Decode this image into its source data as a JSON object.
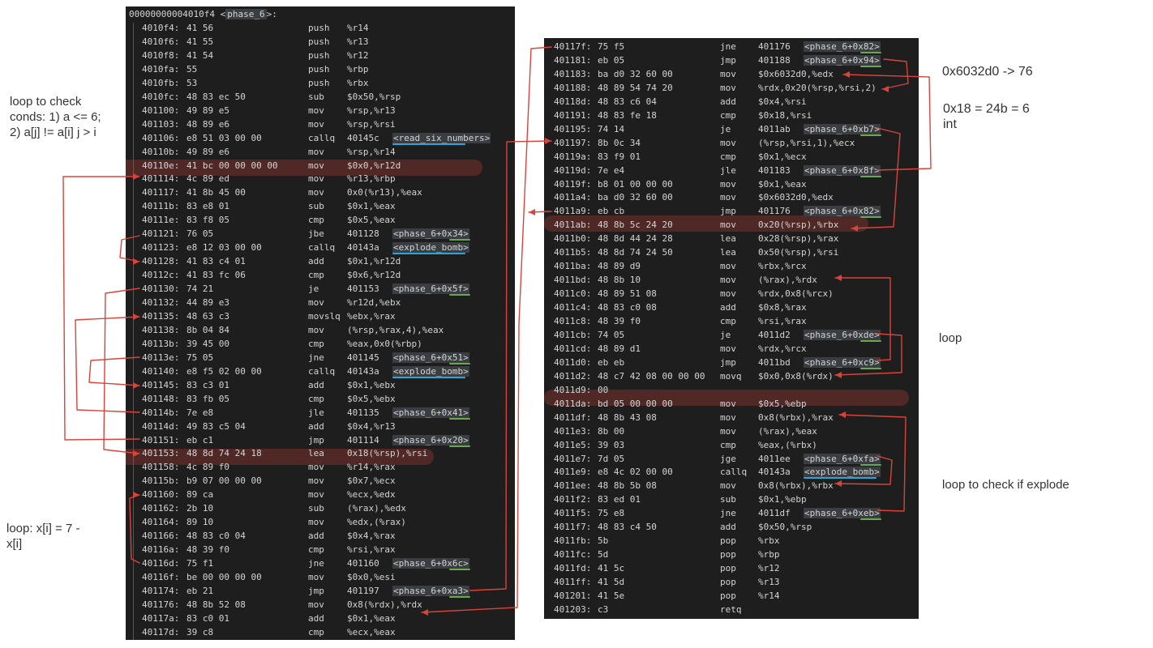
{
  "left_panel": {
    "header": {
      "address": "00000000004010f4",
      "symbol": "phase_6"
    },
    "rows": [
      {
        "addr": "4010f4:",
        "bytes": "41 56",
        "mnemonic": "push",
        "operand": "%r14"
      },
      {
        "addr": "4010f6:",
        "bytes": "41 55",
        "mnemonic": "push",
        "operand": "%r13"
      },
      {
        "addr": "4010f8:",
        "bytes": "41 54",
        "mnemonic": "push",
        "operand": "%r12"
      },
      {
        "addr": "4010fa:",
        "bytes": "55",
        "mnemonic": "push",
        "operand": "%rbp"
      },
      {
        "addr": "4010fb:",
        "bytes": "53",
        "mnemonic": "push",
        "operand": "%rbx"
      },
      {
        "addr": "4010fc:",
        "bytes": "48 83 ec 50",
        "mnemonic": "sub",
        "operand": "$0x50,%rsp"
      },
      {
        "addr": "401100:",
        "bytes": "49 89 e5",
        "mnemonic": "mov",
        "operand": "%rsp,%r13"
      },
      {
        "addr": "401103:",
        "bytes": "48 89 e6",
        "mnemonic": "mov",
        "operand": "%rsp,%rsi"
      },
      {
        "addr": "401106:",
        "bytes": "e8 51 03 00 00",
        "mnemonic": "callq",
        "operand": "40145c ",
        "symbol": "<read_six_numbers>"
      },
      {
        "addr": "40110b:",
        "bytes": "49 89 e6",
        "mnemonic": "mov",
        "operand": "%rsp,%r14"
      },
      {
        "addr": "40110e:",
        "bytes": "41 bc 00 00 00 00",
        "mnemonic": "mov",
        "operand": "$0x0,%r12d"
      },
      {
        "addr": "401114:",
        "bytes": "4c 89 ed",
        "mnemonic": "mov",
        "operand": "%r13,%rbp"
      },
      {
        "addr": "401117:",
        "bytes": "41 8b 45 00",
        "mnemonic": "mov",
        "operand": "0x0(%r13),%eax"
      },
      {
        "addr": "40111b:",
        "bytes": "83 e8 01",
        "mnemonic": "sub",
        "operand": "$0x1,%eax"
      },
      {
        "addr": "40111e:",
        "bytes": "83 f8 05",
        "mnemonic": "cmp",
        "operand": "$0x5,%eax"
      },
      {
        "addr": "401121:",
        "bytes": "76 05",
        "mnemonic": "jbe",
        "operand": "401128 ",
        "symbol": "<phase_6+0x34>"
      },
      {
        "addr": "401123:",
        "bytes": "e8 12 03 00 00",
        "mnemonic": "callq",
        "operand": "40143a ",
        "symbol": "<explode_bomb>"
      },
      {
        "addr": "401128:",
        "bytes": "41 83 c4 01",
        "mnemonic": "add",
        "operand": "$0x1,%r12d"
      },
      {
        "addr": "40112c:",
        "bytes": "41 83 fc 06",
        "mnemonic": "cmp",
        "operand": "$0x6,%r12d"
      },
      {
        "addr": "401130:",
        "bytes": "74 21",
        "mnemonic": "je",
        "operand": "401153 ",
        "symbol": "<phase_6+0x5f>"
      },
      {
        "addr": "401132:",
        "bytes": "44 89 e3",
        "mnemonic": "mov",
        "operand": "%r12d,%ebx"
      },
      {
        "addr": "401135:",
        "bytes": "48 63 c3",
        "mnemonic": "movslq",
        "operand": "%ebx,%rax"
      },
      {
        "addr": "401138:",
        "bytes": "8b 04 84",
        "mnemonic": "mov",
        "operand": "(%rsp,%rax,4),%eax"
      },
      {
        "addr": "40113b:",
        "bytes": "39 45 00",
        "mnemonic": "cmp",
        "operand": "%eax,0x0(%rbp)"
      },
      {
        "addr": "40113e:",
        "bytes": "75 05",
        "mnemonic": "jne",
        "operand": "401145 ",
        "symbol": "<phase_6+0x51>"
      },
      {
        "addr": "401140:",
        "bytes": "e8 f5 02 00 00",
        "mnemonic": "callq",
        "operand": "40143a ",
        "symbol": "<explode_bomb>"
      },
      {
        "addr": "401145:",
        "bytes": "83 c3 01",
        "mnemonic": "add",
        "operand": "$0x1,%ebx"
      },
      {
        "addr": "401148:",
        "bytes": "83 fb 05",
        "mnemonic": "cmp",
        "operand": "$0x5,%ebx"
      },
      {
        "addr": "40114b:",
        "bytes": "7e e8",
        "mnemonic": "jle",
        "operand": "401135 ",
        "symbol": "<phase_6+0x41>"
      },
      {
        "addr": "40114d:",
        "bytes": "49 83 c5 04",
        "mnemonic": "add",
        "operand": "$0x4,%r13"
      },
      {
        "addr": "401151:",
        "bytes": "eb c1",
        "mnemonic": "jmp",
        "operand": "401114 ",
        "symbol": "<phase_6+0x20>"
      },
      {
        "addr": "401153:",
        "bytes": "48 8d 74 24 18",
        "mnemonic": "lea",
        "operand": "0x18(%rsp),%rsi"
      },
      {
        "addr": "401158:",
        "bytes": "4c 89 f0",
        "mnemonic": "mov",
        "operand": "%r14,%rax"
      },
      {
        "addr": "40115b:",
        "bytes": "b9 07 00 00 00",
        "mnemonic": "mov",
        "operand": "$0x7,%ecx"
      },
      {
        "addr": "401160:",
        "bytes": "89 ca",
        "mnemonic": "mov",
        "operand": "%ecx,%edx"
      },
      {
        "addr": "401162:",
        "bytes": "2b 10",
        "mnemonic": "sub",
        "operand": "(%rax),%edx"
      },
      {
        "addr": "401164:",
        "bytes": "89 10",
        "mnemonic": "mov",
        "operand": "%edx,(%rax)"
      },
      {
        "addr": "401166:",
        "bytes": "48 83 c0 04",
        "mnemonic": "add",
        "operand": "$0x4,%rax"
      },
      {
        "addr": "40116a:",
        "bytes": "48 39 f0",
        "mnemonic": "cmp",
        "operand": "%rsi,%rax"
      },
      {
        "addr": "40116d:",
        "bytes": "75 f1",
        "mnemonic": "jne",
        "operand": "401160 ",
        "symbol": "<phase_6+0x6c>"
      },
      {
        "addr": "40116f:",
        "bytes": "be 00 00 00 00",
        "mnemonic": "mov",
        "operand": "$0x0,%esi"
      },
      {
        "addr": "401174:",
        "bytes": "eb 21",
        "mnemonic": "jmp",
        "operand": "401197 ",
        "symbol": "<phase_6+0xa3>"
      },
      {
        "addr": "401176:",
        "bytes": "48 8b 52 08",
        "mnemonic": "mov",
        "operand": "0x8(%rdx),%rdx"
      },
      {
        "addr": "40117a:",
        "bytes": "83 c0 01",
        "mnemonic": "add",
        "operand": "$0x1,%eax"
      },
      {
        "addr": "40117d:",
        "bytes": "39 c8",
        "mnemonic": "cmp",
        "operand": "%ecx,%eax"
      }
    ]
  },
  "right_panel": {
    "rows": [
      {
        "addr": "40117f:",
        "bytes": "75 f5",
        "mnemonic": "jne",
        "operand": "401176 ",
        "symbol": "<phase_6+0x82>"
      },
      {
        "addr": "401181:",
        "bytes": "eb 05",
        "mnemonic": "jmp",
        "operand": "401188 ",
        "symbol": "<phase_6+0x94>"
      },
      {
        "addr": "401183:",
        "bytes": "ba d0 32 60 00",
        "mnemonic": "mov",
        "operand": "$0x6032d0,%edx"
      },
      {
        "addr": "401188:",
        "bytes": "48 89 54 74 20",
        "mnemonic": "mov",
        "operand": "%rdx,0x20(%rsp,%rsi,2)"
      },
      {
        "addr": "40118d:",
        "bytes": "48 83 c6 04",
        "mnemonic": "add",
        "operand": "$0x4,%rsi"
      },
      {
        "addr": "401191:",
        "bytes": "48 83 fe 18",
        "mnemonic": "cmp",
        "operand": "$0x18,%rsi"
      },
      {
        "addr": "401195:",
        "bytes": "74 14",
        "mnemonic": "je",
        "operand": "4011ab ",
        "symbol": "<phase_6+0xb7>"
      },
      {
        "addr": "401197:",
        "bytes": "8b 0c 34",
        "mnemonic": "mov",
        "operand": "(%rsp,%rsi,1),%ecx"
      },
      {
        "addr": "40119a:",
        "bytes": "83 f9 01",
        "mnemonic": "cmp",
        "operand": "$0x1,%ecx"
      },
      {
        "addr": "40119d:",
        "bytes": "7e e4",
        "mnemonic": "jle",
        "operand": "401183 ",
        "symbol": "<phase_6+0x8f>"
      },
      {
        "addr": "40119f:",
        "bytes": "b8 01 00 00 00",
        "mnemonic": "mov",
        "operand": "$0x1,%eax"
      },
      {
        "addr": "4011a4:",
        "bytes": "ba d0 32 60 00",
        "mnemonic": "mov",
        "operand": "$0x6032d0,%edx"
      },
      {
        "addr": "4011a9:",
        "bytes": "eb cb",
        "mnemonic": "jmp",
        "operand": "401176 ",
        "symbol": "<phase_6+0x82>"
      },
      {
        "addr": "4011ab:",
        "bytes": "48 8b 5c 24 20",
        "mnemonic": "mov",
        "operand": "0x20(%rsp),%rbx"
      },
      {
        "addr": "4011b0:",
        "bytes": "48 8d 44 24 28",
        "mnemonic": "lea",
        "operand": "0x28(%rsp),%rax"
      },
      {
        "addr": "4011b5:",
        "bytes": "48 8d 74 24 50",
        "mnemonic": "lea",
        "operand": "0x50(%rsp),%rsi"
      },
      {
        "addr": "4011ba:",
        "bytes": "48 89 d9",
        "mnemonic": "mov",
        "operand": "%rbx,%rcx"
      },
      {
        "addr": "4011bd:",
        "bytes": "48 8b 10",
        "mnemonic": "mov",
        "operand": "(%rax),%rdx"
      },
      {
        "addr": "4011c0:",
        "bytes": "48 89 51 08",
        "mnemonic": "mov",
        "operand": "%rdx,0x8(%rcx)"
      },
      {
        "addr": "4011c4:",
        "bytes": "48 83 c0 08",
        "mnemonic": "add",
        "operand": "$0x8,%rax"
      },
      {
        "addr": "4011c8:",
        "bytes": "48 39 f0",
        "mnemonic": "cmp",
        "operand": "%rsi,%rax"
      },
      {
        "addr": "4011cb:",
        "bytes": "74 05",
        "mnemonic": "je",
        "operand": "4011d2 ",
        "symbol": "<phase_6+0xde>"
      },
      {
        "addr": "4011cd:",
        "bytes": "48 89 d1",
        "mnemonic": "mov",
        "operand": "%rdx,%rcx"
      },
      {
        "addr": "4011d0:",
        "bytes": "eb eb",
        "mnemonic": "jmp",
        "operand": "4011bd ",
        "symbol": "<phase_6+0xc9>"
      },
      {
        "addr": "4011d2:",
        "bytes": "48 c7 42 08 00 00 00",
        "mnemonic": "movq",
        "operand": "$0x0,0x8(%rdx)"
      },
      {
        "addr": "4011d9:",
        "bytes": "00",
        "mnemonic": "",
        "operand": ""
      },
      {
        "addr": "4011da:",
        "bytes": "bd 05 00 00 00",
        "mnemonic": "mov",
        "operand": "$0x5,%ebp"
      },
      {
        "addr": "4011df:",
        "bytes": "48 8b 43 08",
        "mnemonic": "mov",
        "operand": "0x8(%rbx),%rax"
      },
      {
        "addr": "4011e3:",
        "bytes": "8b 00",
        "mnemonic": "mov",
        "operand": "(%rax),%eax"
      },
      {
        "addr": "4011e5:",
        "bytes": "39 03",
        "mnemonic": "cmp",
        "operand": "%eax,(%rbx)"
      },
      {
        "addr": "4011e7:",
        "bytes": "7d 05",
        "mnemonic": "jge",
        "operand": "4011ee ",
        "symbol": "<phase_6+0xfa>"
      },
      {
        "addr": "4011e9:",
        "bytes": "e8 4c 02 00 00",
        "mnemonic": "callq",
        "operand": "40143a ",
        "symbol": "<explode_bomb>"
      },
      {
        "addr": "4011ee:",
        "bytes": "48 8b 5b 08",
        "mnemonic": "mov",
        "operand": "0x8(%rbx),%rbx"
      },
      {
        "addr": "4011f2:",
        "bytes": "83 ed 01",
        "mnemonic": "sub",
        "operand": "$0x1,%ebp"
      },
      {
        "addr": "4011f5:",
        "bytes": "75 e8",
        "mnemonic": "jne",
        "operand": "4011df ",
        "symbol": "<phase_6+0xeb>"
      },
      {
        "addr": "4011f7:",
        "bytes": "48 83 c4 50",
        "mnemonic": "add",
        "operand": "$0x50,%rsp"
      },
      {
        "addr": "4011fb:",
        "bytes": "5b",
        "mnemonic": "pop",
        "operand": "%rbx"
      },
      {
        "addr": "4011fc:",
        "bytes": "5d",
        "mnemonic": "pop",
        "operand": "%rbp"
      },
      {
        "addr": "4011fd:",
        "bytes": "41 5c",
        "mnemonic": "pop",
        "operand": "%r12"
      },
      {
        "addr": "4011ff:",
        "bytes": "41 5d",
        "mnemonic": "pop",
        "operand": "%r13"
      },
      {
        "addr": "401201:",
        "bytes": "41 5e",
        "mnemonic": "pop",
        "operand": "%r14"
      },
      {
        "addr": "401203:",
        "bytes": "c3",
        "mnemonic": "retq",
        "operand": ""
      }
    ]
  },
  "annotations": {
    "loop_check_conds": "loop to check\nconds: 1) a <= 6;\n2) a[j] != a[i] j > i",
    "loop_x": "loop: x[i] = 7 -\nx[i]",
    "node_addr": "0x6032d0 -> 76",
    "hex_18": "0x18 = 24b = 6\nint",
    "loop": "loop",
    "loop_explode": "loop to check if explode"
  },
  "colors": {
    "panel_bg": "#1e1e1e",
    "code_text": "#d4d4d4",
    "arrow_red": "#d9443a",
    "highlight_red": "rgba(200,70,60,0.30)",
    "underline_cyan": "#2aa7d8",
    "underline_green": "#6aa84f",
    "underline_yellow": "#e0a030"
  }
}
